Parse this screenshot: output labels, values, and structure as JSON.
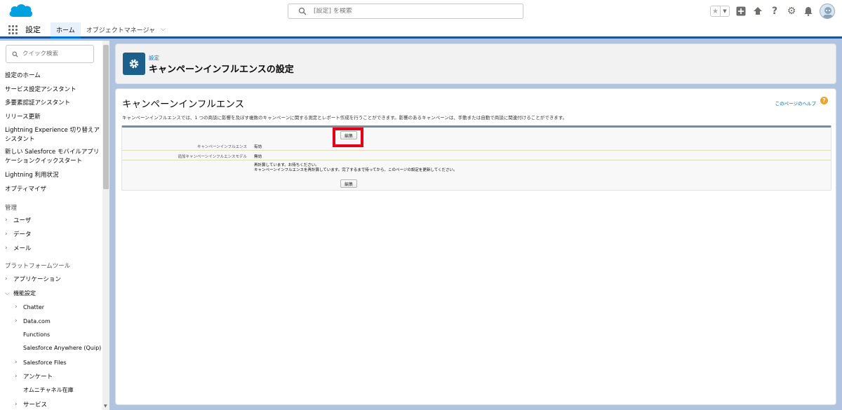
{
  "header": {
    "search_placeholder": "[設定] を検索"
  },
  "context_bar": {
    "app_name": "設定",
    "tabs": [
      {
        "label": "ホーム"
      },
      {
        "label": "オブジェクトマネージャ"
      }
    ]
  },
  "sidebar": {
    "quick_find_placeholder": "クイック検索",
    "items": [
      {
        "label": "設定のホーム"
      },
      {
        "label": "サービス設定アシスタント"
      },
      {
        "label": "多要素認証アシスタント"
      },
      {
        "label": "リリース更新"
      },
      {
        "label": "Lightning Experience 切り替えアシスタント"
      },
      {
        "label": "新しい Salesforce モバイルアプリケーションクイックスタート"
      },
      {
        "label": "Lightning 利用状況"
      },
      {
        "label": "オプティマイザ"
      }
    ],
    "section_admin": "管理",
    "admin_items": [
      {
        "label": "ユーザ"
      },
      {
        "label": "データ"
      },
      {
        "label": "メール"
      }
    ],
    "section_platform": "プラットフォームツール",
    "platform_items": [
      {
        "label": "アプリケーション"
      },
      {
        "label": "機能設定"
      }
    ],
    "feature_children": [
      {
        "label": "Chatter"
      },
      {
        "label": "Data.com"
      },
      {
        "label": "Functions"
      },
      {
        "label": "Salesforce Anywhere (Quip)"
      },
      {
        "label": "Salesforce Files"
      },
      {
        "label": "アンケート"
      },
      {
        "label": "オムニチャネル在庫"
      },
      {
        "label": "サービス"
      }
    ]
  },
  "page_header": {
    "breadcrumb": "設定",
    "title": "キャンペーンインフルエンスの設定"
  },
  "content": {
    "title": "キャンペーンインフルエンス",
    "help_link": "このページのヘルプ",
    "description": "キャンペーンインフルエンスでは、1 つの商談に影響を及ぼす複数のキャンペーンに関する測定とレポート作成を行うことができます。影響のあるキャンペーンは、手動または自動で商談に関連付けることができます。",
    "edit_button": "編集",
    "fields": [
      {
        "label": "キャンペーンインフルエンス",
        "value": "有効"
      },
      {
        "label": "追加キャンペーンインフルエンスモデル",
        "value": "無効"
      }
    ],
    "message_line1": "再計算しています。お待ちください。",
    "message_line2": "キャンペーンインフルエンスを再計算しています。完了するまで待ってから、このページの設定を更新してください。",
    "edit_button_bottom": "編集"
  },
  "colors": {
    "brand_blue": "#1b5297",
    "highlight_red": "#e2001a",
    "link_blue": "#0070d2"
  }
}
